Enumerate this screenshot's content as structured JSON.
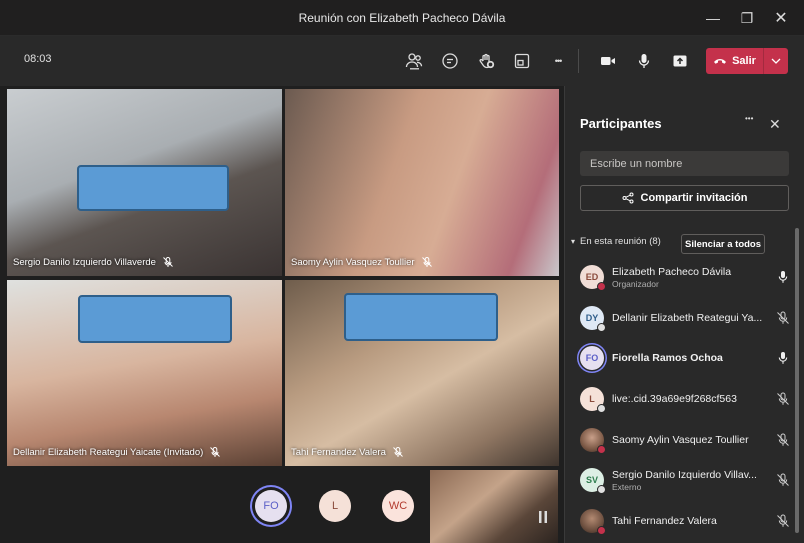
{
  "window": {
    "title": "Reunión con Elizabeth Pacheco Dávila",
    "minimize_glyph": "—",
    "maximize_glyph": "❐",
    "close_glyph": "✕"
  },
  "toolbar": {
    "time": "08:03",
    "more_glyph": "•••",
    "leave_label": "Salir"
  },
  "videos": [
    {
      "name": "Sergio Danilo Izquierdo Villaverde",
      "muted": true
    },
    {
      "name": "Saomy Aylin Vasquez Toullier",
      "muted": true
    },
    {
      "name": "Dellanir Elizabeth Reategui Yaicate (Invitado)",
      "muted": true
    },
    {
      "name": "Tahi Fernandez Valera",
      "muted": true
    }
  ],
  "bottom_avatars": [
    {
      "initials": "FO",
      "bg": "#e6e0f0",
      "fg": "#5b5fc7"
    },
    {
      "initials": "L",
      "bg": "#f5e1d8",
      "fg": "#8a4b3c"
    },
    {
      "initials": "WC",
      "bg": "#fbe3dc",
      "fg": "#b33b2f"
    }
  ],
  "panel": {
    "title": "Participantes",
    "more_glyph": "•••",
    "close_glyph": "✕",
    "search_placeholder": "Escribe un nombre",
    "invite_label": "Compartir invitación",
    "section_label": "En esta reunión (8)",
    "section_arrow": "▾",
    "mute_all_label": "Silenciar a todos",
    "participants": [
      {
        "initials": "ED",
        "name": "Elizabeth Pacheco Dávila",
        "role": "Organizador",
        "avatar_bg": "#f0ddd6",
        "avatar_fg": "#8a4b3c",
        "status_color": "#c4314b",
        "mic": "on"
      },
      {
        "initials": "DY",
        "name": "Dellanir Elizabeth Reategui Ya...",
        "role": "",
        "avatar_bg": "#dfe9f5",
        "avatar_fg": "#2f5d8a",
        "status_color": "#e0e0e0",
        "mic": "off"
      },
      {
        "initials": "FO",
        "name": "Fiorella Ramos Ochoa",
        "role": "",
        "avatar_bg": "#e6e0f0",
        "avatar_fg": "#5b5fc7",
        "status_color": "#5b5fc7",
        "mic": "on"
      },
      {
        "initials": "L",
        "name": "live:.cid.39a69e9f268cf563",
        "role": "",
        "avatar_bg": "#f5e1d8",
        "avatar_fg": "#8a4b3c",
        "status_color": "#e0e0e0",
        "mic": "off"
      },
      {
        "initials": "",
        "name": "Saomy Aylin Vasquez Toullier",
        "role": "",
        "avatar_bg": "#a07a63",
        "avatar_fg": "#fff",
        "status_color": "#c4314b",
        "mic": "off"
      },
      {
        "initials": "SV",
        "name": "Sergio Danilo Izquierdo Villav...",
        "role": "Externo",
        "avatar_bg": "#dcefe4",
        "avatar_fg": "#2d7d4e",
        "status_color": "#e0e0e0",
        "mic": "off"
      },
      {
        "initials": "",
        "name": "Tahi Fernandez Valera",
        "role": "",
        "avatar_bg": "#8e6b55",
        "avatar_fg": "#fff",
        "status_color": "#c4314b",
        "mic": "off"
      }
    ]
  }
}
